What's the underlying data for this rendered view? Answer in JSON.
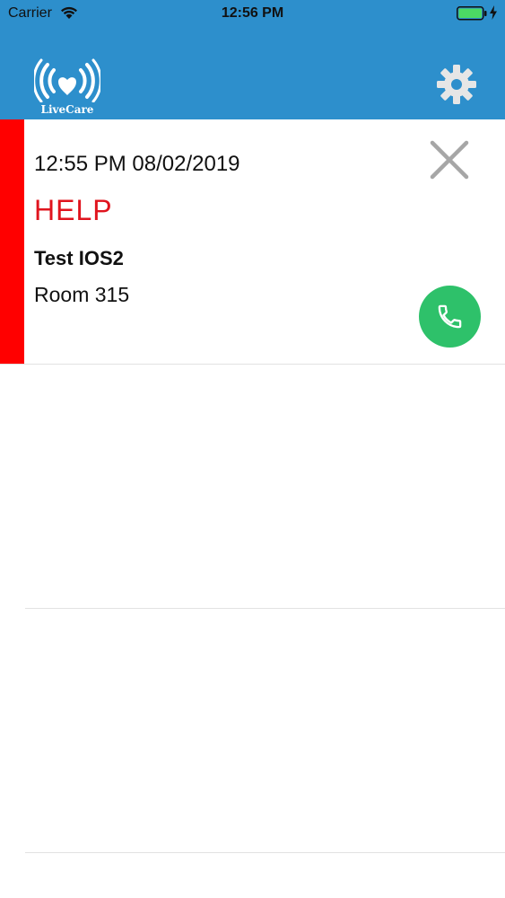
{
  "status_bar": {
    "carrier": "Carrier",
    "time": "12:56 PM",
    "wifi_icon": "wifi-icon",
    "battery_icon": "battery-icon",
    "battery_level": 1.0
  },
  "header": {
    "logo_text": "LiveCare",
    "background_color": "#2d8fcc",
    "settings_icon": "gear-icon"
  },
  "alert": {
    "time": "12:55 PM 08/02/2019",
    "type": "HELP",
    "name": "Test IOS2",
    "room": "Room 315",
    "strip_color": "#ff0000",
    "type_color": "#e0141e",
    "close_icon": "close-icon",
    "call_icon": "phone-icon",
    "call_color": "#2ec16a"
  }
}
